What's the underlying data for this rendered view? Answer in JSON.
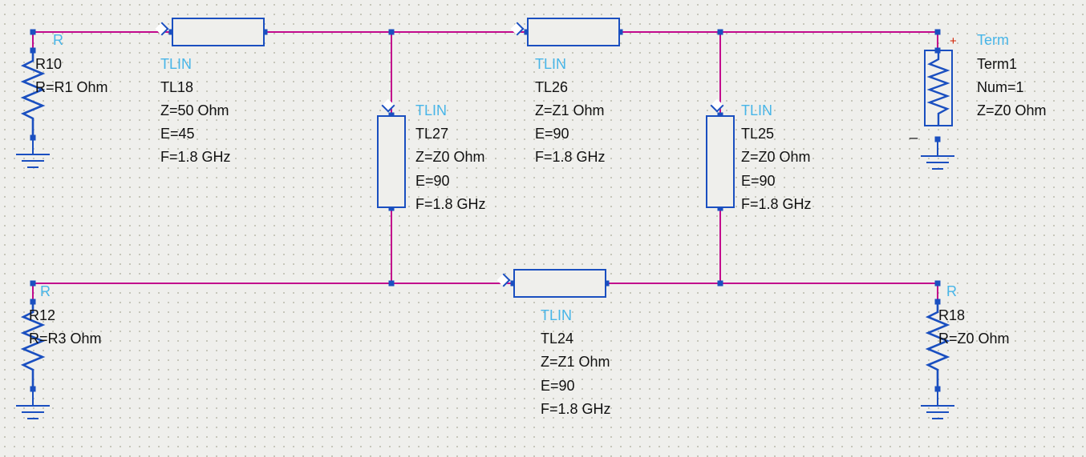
{
  "components": {
    "r10": {
      "type": "R",
      "name": "R10",
      "params": [
        "R=R1 Ohm"
      ]
    },
    "r12": {
      "type": "R",
      "name": "R12",
      "params": [
        "R=R3 Ohm"
      ]
    },
    "r18": {
      "type": "R",
      "name": "R18",
      "params": [
        "R=Z0 Ohm"
      ]
    },
    "tl18": {
      "type": "TLIN",
      "name": "TL18",
      "params": [
        "Z=50 Ohm",
        "E=45",
        "F=1.8 GHz"
      ]
    },
    "tl27": {
      "type": "TLIN",
      "name": "TL27",
      "params": [
        "Z=Z0 Ohm",
        "E=90",
        "F=1.8 GHz"
      ]
    },
    "tl26": {
      "type": "TLIN",
      "name": "TL26",
      "params": [
        "Z=Z1 Ohm",
        "E=90",
        "F=1.8 GHz"
      ]
    },
    "tl25": {
      "type": "TLIN",
      "name": "TL25",
      "params": [
        "Z=Z0 Ohm",
        "E=90",
        "F=1.8 GHz"
      ]
    },
    "tl24": {
      "type": "TLIN",
      "name": "TL24",
      "params": [
        "Z=Z1 Ohm",
        "E=90",
        "F=1.8 GHz"
      ]
    },
    "term1": {
      "type": "Term",
      "name": "Term1",
      "params": [
        "Num=1",
        "Z=Z0 Ohm"
      ]
    }
  },
  "colors": {
    "symbol": "#1a4fc0",
    "wire": "#c20a8c",
    "type_label": "#47b5e8",
    "text": "#111111"
  }
}
